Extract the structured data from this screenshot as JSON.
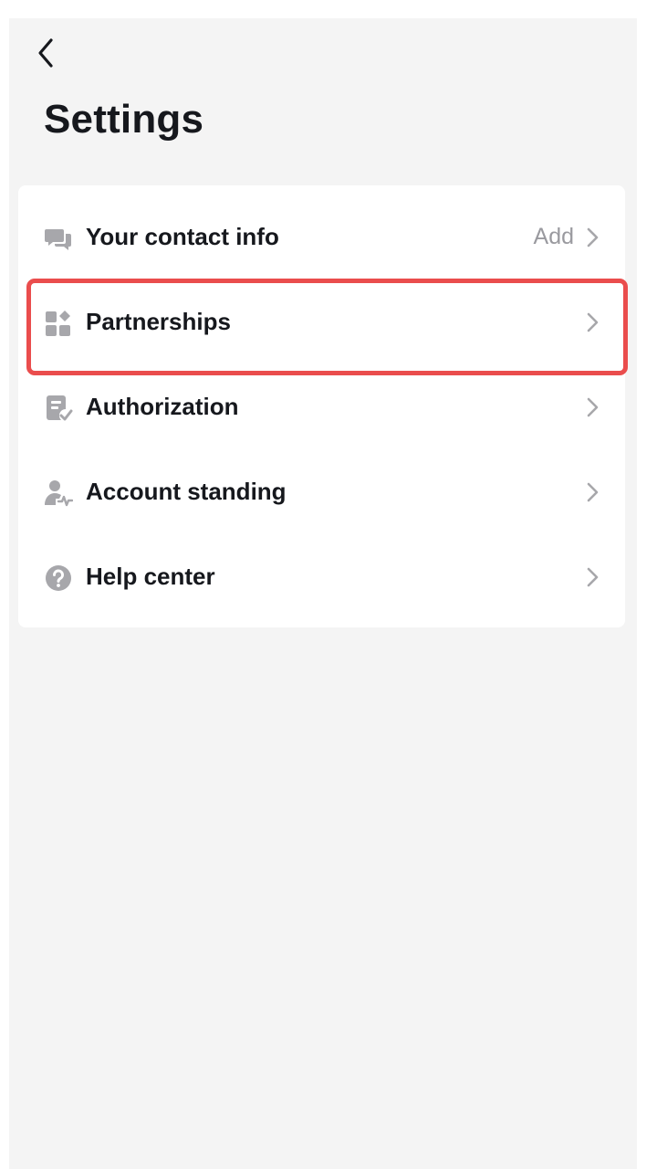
{
  "header": {
    "back_icon": "chevron-left-icon",
    "title": "Settings"
  },
  "settings": {
    "items": [
      {
        "label": "Your contact info",
        "value": "Add",
        "icon": "chat-bubbles-icon",
        "chevron_icon": "chevron-right-icon"
      },
      {
        "label": "Partnerships",
        "value": "",
        "icon": "widgets-icon",
        "chevron_icon": "chevron-right-icon"
      },
      {
        "label": "Authorization",
        "value": "",
        "icon": "document-check-icon",
        "chevron_icon": "chevron-right-icon"
      },
      {
        "label": "Account standing",
        "value": "",
        "icon": "user-status-icon",
        "chevron_icon": "chevron-right-icon"
      },
      {
        "label": "Help center",
        "value": "",
        "icon": "question-circle-icon",
        "chevron_icon": "chevron-right-icon"
      }
    ]
  },
  "highlight": {
    "target": "Partnerships",
    "color": "#ea4d4d"
  },
  "colors": {
    "background": "#f4f4f4",
    "card": "#ffffff",
    "text_primary": "#16181d",
    "text_secondary": "#9a9a9f",
    "icon": "#a7a7ab"
  }
}
